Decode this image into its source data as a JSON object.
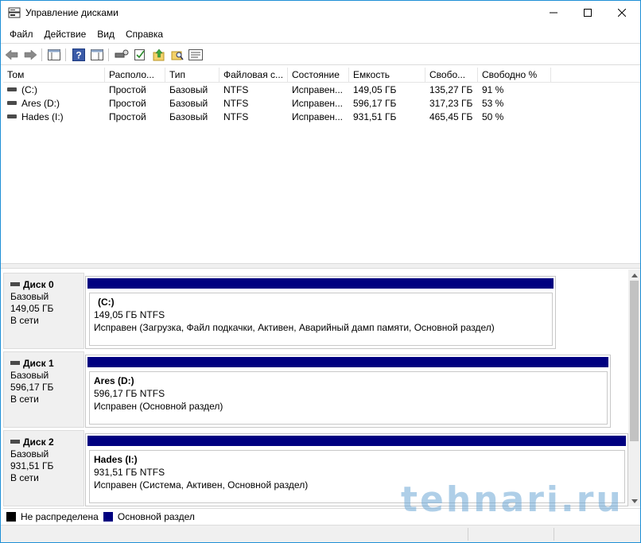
{
  "window": {
    "title": "Управление дисками"
  },
  "menu": [
    {
      "label": "Файл"
    },
    {
      "label": "Действие"
    },
    {
      "label": "Вид"
    },
    {
      "label": "Справка"
    }
  ],
  "volumes": {
    "columns": [
      "Том",
      "Располо...",
      "Тип",
      "Файловая с...",
      "Состояние",
      "Емкость",
      "Свобо...",
      "Свободно %"
    ],
    "rows": [
      [
        "(C:)",
        "Простой",
        "Базовый",
        "NTFS",
        "Исправен...",
        "149,05 ГБ",
        "135,27 ГБ",
        "91 %"
      ],
      [
        "Ares (D:)",
        "Простой",
        "Базовый",
        "NTFS",
        "Исправен...",
        "596,17 ГБ",
        "317,23 ГБ",
        "53 %"
      ],
      [
        "Hades (I:)",
        "Простой",
        "Базовый",
        "NTFS",
        "Исправен...",
        "931,51 ГБ",
        "465,45 ГБ",
        "50 %"
      ]
    ]
  },
  "disks": [
    {
      "name": "Диск 0",
      "type": "Базовый",
      "size": "149,05 ГБ",
      "status": "В сети",
      "partition": {
        "name": "(C:)",
        "size_fs": "149,05 ГБ NTFS",
        "state": "Исправен (Загрузка, Файл подкачки, Активен, Аварийный дамп памяти, Основной раздел)"
      }
    },
    {
      "name": "Диск 1",
      "type": "Базовый",
      "size": "596,17 ГБ",
      "status": "В сети",
      "partition": {
        "name": "Ares  (D:)",
        "size_fs": "596,17 ГБ NTFS",
        "state": "Исправен (Основной раздел)"
      }
    },
    {
      "name": "Диск 2",
      "type": "Базовый",
      "size": "931,51 ГБ",
      "status": "В сети",
      "partition": {
        "name": "Hades  (I:)",
        "size_fs": "931,51 ГБ NTFS",
        "state": "Исправен (Система, Активен, Основной раздел)"
      }
    }
  ],
  "legend": [
    {
      "label": "Не распределена",
      "color": "#000000"
    },
    {
      "label": "Основной раздел",
      "color": "#000080"
    }
  ],
  "colors": {
    "primary_partition": "#000080",
    "unallocated": "#000000",
    "window_border": "#1e8fd6"
  },
  "watermark": "tehnari.ru"
}
